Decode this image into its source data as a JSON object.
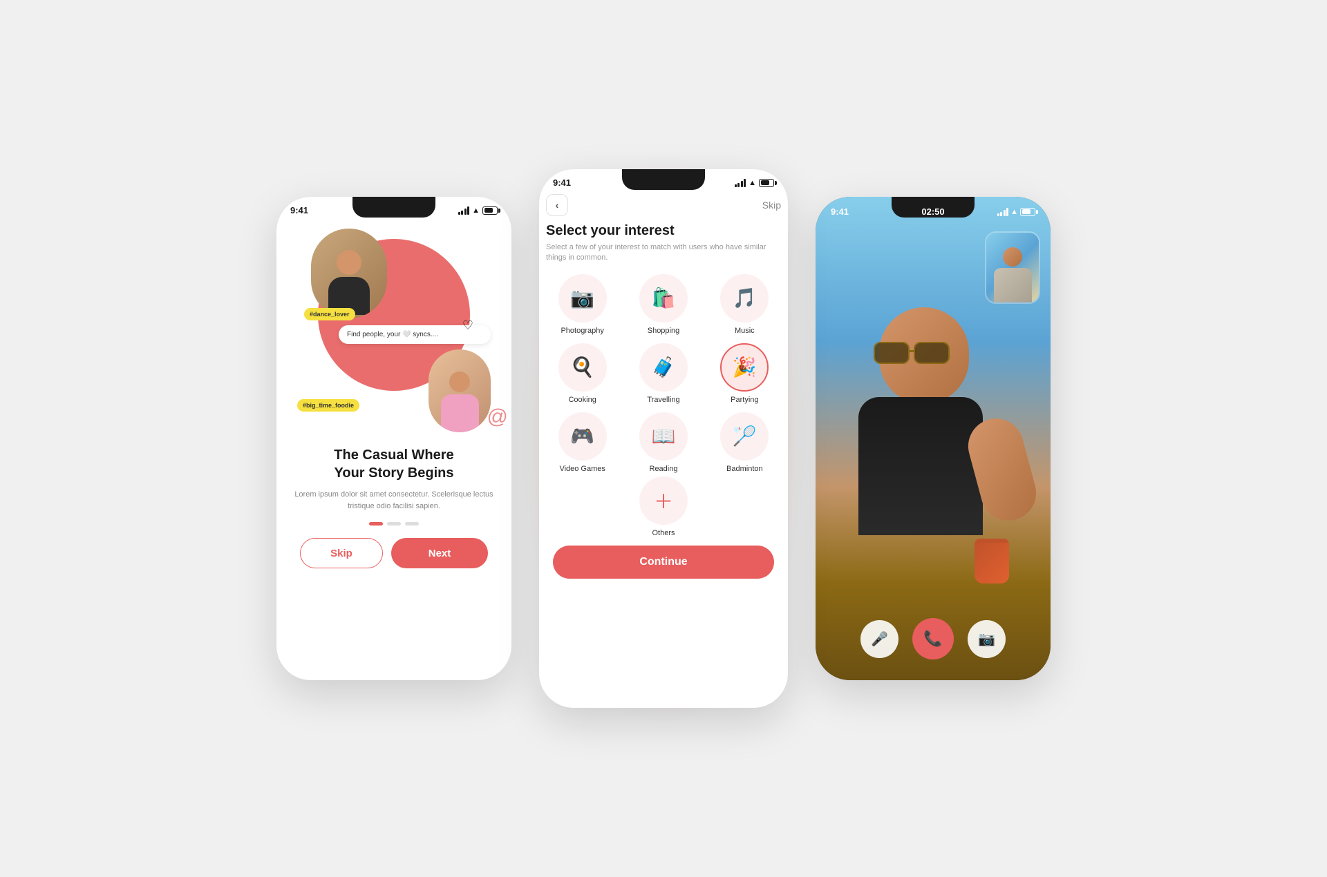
{
  "phone1": {
    "statusTime": "9:41",
    "tag1": "#dance_lover",
    "tag2": "#big_time_foodie",
    "syncsBanner": "Find people, your 🤍 syncs....",
    "title": "The Casual Where\nYour Story Begins",
    "description": "Lorem ipsum dolor sit amet consectetur. Scelerisque lectus tristique odio facilisi sapien.",
    "skipLabel": "Skip",
    "nextLabel": "Next",
    "dots": [
      {
        "active": true
      },
      {
        "active": false
      },
      {
        "active": false
      }
    ]
  },
  "phone2": {
    "statusTime": "9:41",
    "backLabel": "‹",
    "skipLabel": "Skip",
    "title": "Select your interest",
    "description": "Select a few of your interest to match with users who have similar things in common.",
    "interests": [
      {
        "label": "Photography",
        "emoji": "📷",
        "selected": false
      },
      {
        "label": "Shopping",
        "emoji": "🛍️",
        "selected": false
      },
      {
        "label": "Music",
        "emoji": "🎵",
        "selected": false
      },
      {
        "label": "Cooking",
        "emoji": "🍳",
        "selected": false
      },
      {
        "label": "Travelling",
        "emoji": "🧳",
        "selected": false
      },
      {
        "label": "Partying",
        "emoji": "🎉",
        "selected": true
      },
      {
        "label": "Video Games",
        "emoji": "🎮",
        "selected": false
      },
      {
        "label": "Reading",
        "emoji": "📖",
        "selected": false
      },
      {
        "label": "Badminton",
        "emoji": "🏸",
        "selected": false
      }
    ],
    "othersLabel": "Others",
    "continueLabel": "Continue"
  },
  "phone3": {
    "statusTime": "9:41",
    "callTime": "02:50",
    "mutedLabel": "muted",
    "endCallLabel": "end",
    "cameraLabel": "camera"
  },
  "colors": {
    "accent": "#e85d5d",
    "accentLight": "#fdf0f0",
    "textDark": "#1a1a1a",
    "textGray": "#888888"
  }
}
